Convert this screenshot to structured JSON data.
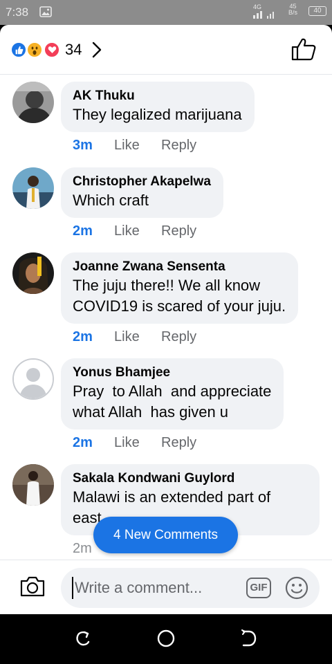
{
  "status_bar": {
    "time": "7:38",
    "network": "4G",
    "speed_value": "45",
    "speed_unit": "B/s",
    "battery": "40"
  },
  "header": {
    "reaction_icons": [
      "like-icon",
      "wow-icon",
      "love-icon"
    ],
    "reaction_count": "34"
  },
  "comments": [
    {
      "author": "AK Thuku",
      "text": "They legalized marijuana",
      "time": "3m",
      "like": "Like",
      "reply": "Reply"
    },
    {
      "author": "Christopher Akapelwa",
      "text": "Which craft",
      "time": "2m",
      "like": "Like",
      "reply": "Reply"
    },
    {
      "author": "Joanne Zwana Sensenta",
      "text_line1": "The juju there!! We all know",
      "text_line2": "COVID19 is scared of your juju.",
      "time": "2m",
      "like": "Like",
      "reply": "Reply"
    },
    {
      "author": "Yonus Bhamjee",
      "text_line1": "Pray  to Allah  and appreciate",
      "text_line2": "what Allah  has given u",
      "time": "2m",
      "like": "Like",
      "reply": "Reply"
    },
    {
      "author": "Sakala Kondwani Guylord",
      "text_line1": "Malawi is an extended part of",
      "text_line2": "east",
      "time": "2m"
    }
  ],
  "new_comments_label": "4 New Comments",
  "composer": {
    "placeholder": "Write a comment...",
    "gif_label": "GIF"
  },
  "colors": {
    "accent": "#1b74e4",
    "bubble": "#f0f2f5",
    "secondary_text": "#65676b"
  }
}
